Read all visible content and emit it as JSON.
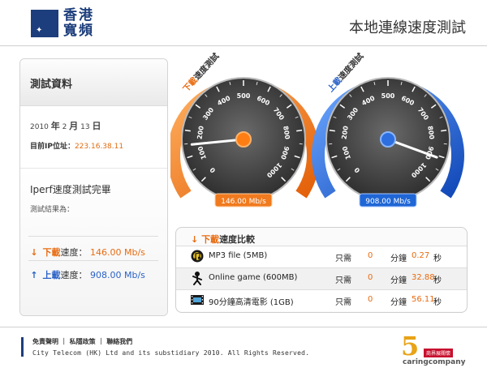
{
  "header": {
    "brand_line1": "香港",
    "brand_line2": "寬頻",
    "title": "本地連線速度測試"
  },
  "info": {
    "title": "測試資料",
    "date_year": "2010",
    "date_year_unit": "年",
    "date_month": "2",
    "date_month_unit": "月",
    "date_day": "13",
    "date_day_unit": "日",
    "ip_label": "目前IP位址：",
    "ip_value": "223.16.38.11",
    "done_title": "Iperf速度測試完畢",
    "result_label": "測試結果為：",
    "download_prefix": "下載",
    "download_suffix": "速度：",
    "download_value": "146.00",
    "download_unit": "Mb/s",
    "upload_prefix": "上載",
    "upload_suffix": "速度：",
    "upload_value": "908.00",
    "upload_unit": "Mb/s"
  },
  "gauges": {
    "download": {
      "label_prefix": "下載",
      "label_suffix": "速度測試",
      "readout": "146.00 Mb/s",
      "value": 146,
      "color": "#f07a1e"
    },
    "upload": {
      "label_prefix": "上載",
      "label_suffix": "速度測試",
      "readout": "908.00 Mb/s",
      "value": 908,
      "color": "#1f66d6"
    },
    "scale_max": 1000,
    "ticks": [
      "0",
      "100",
      "200",
      "300",
      "400",
      "500",
      "600",
      "700",
      "800",
      "900",
      "1000"
    ]
  },
  "compare": {
    "title_prefix": "下載",
    "title_suffix": "速度比較",
    "rows": [
      {
        "name": "MP3 file (5MB)",
        "icon": "music-icon",
        "need": "只需",
        "zero": "0",
        "min": "分鐘",
        "sec": "0.27",
        "secl": "秒"
      },
      {
        "name": "Online game (600MB)",
        "icon": "game-icon",
        "need": "只需",
        "zero": "0",
        "min": "分鐘",
        "sec": "32.88",
        "secl": "秒"
      },
      {
        "name": "90分鐘高清電影 (1GB)",
        "icon": "film-icon",
        "need": "只需",
        "zero": "0",
        "min": "分鐘",
        "sec": "56.11",
        "secl": "秒"
      }
    ]
  },
  "footer": {
    "link1": "免責聲明",
    "link2": "私隱政策",
    "link3": "聯絡我們",
    "divider": "｜",
    "copyright": "City Telecom (HK) Ltd and its substidiary 2010. All Rights Reserved.",
    "caring_badge": "商界展關懷",
    "caring_text": "caringcompany",
    "caring_number": "5"
  },
  "colors": {
    "brand": "#1d3e7c",
    "accent_orange": "#e86b10",
    "accent_blue": "#2b62c7"
  }
}
